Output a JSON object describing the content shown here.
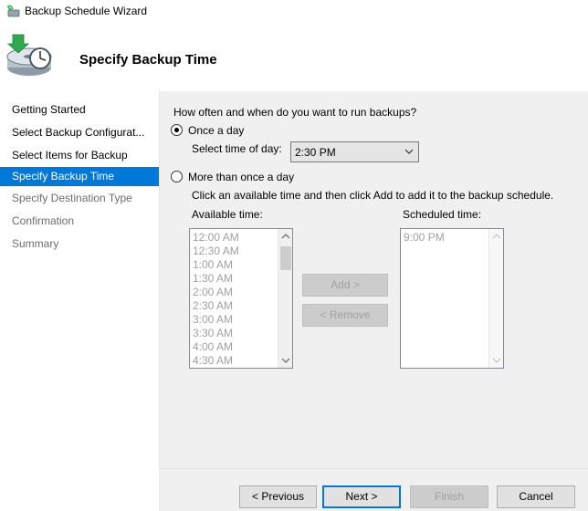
{
  "window": {
    "title": "Backup Schedule Wizard",
    "page_title": "Specify Backup Time"
  },
  "sidebar": {
    "steps": [
      {
        "label": "Getting Started"
      },
      {
        "label": "Select Backup Configurat..."
      },
      {
        "label": "Select Items for Backup"
      },
      {
        "label": "Specify Backup Time"
      },
      {
        "label": "Specify Destination Type"
      },
      {
        "label": "Confirmation"
      },
      {
        "label": "Summary"
      }
    ],
    "active_index": 3
  },
  "main": {
    "question": "How often and when do you want to run backups?",
    "once_a_day": {
      "label": "Once a day",
      "selected": true
    },
    "select_time_label": "Select time of day:",
    "time_of_day": "2:30 PM",
    "more_than_once": {
      "label": "More than once a day",
      "selected": false
    },
    "instructions": "Click an available time and then click Add to add it to the backup schedule.",
    "available_label": "Available time:",
    "scheduled_label": "Scheduled time:",
    "available_times": [
      "12:00 AM",
      "12:30 AM",
      "1:00 AM",
      "1:30 AM",
      "2:00 AM",
      "2:30 AM",
      "3:00 AM",
      "3:30 AM",
      "4:00 AM",
      "4:30 AM"
    ],
    "scheduled_times": [
      "9:00 PM"
    ],
    "add_label": "Add >",
    "remove_label": "< Remove"
  },
  "footer": {
    "previous_label": "< Previous",
    "next_label": "Next >",
    "finish_label": "Finish",
    "cancel_label": "Cancel"
  },
  "colors": {
    "accent": "#0078d7",
    "content_bg": "#f0f0f0",
    "disabled_text": "#a0a0a0"
  }
}
